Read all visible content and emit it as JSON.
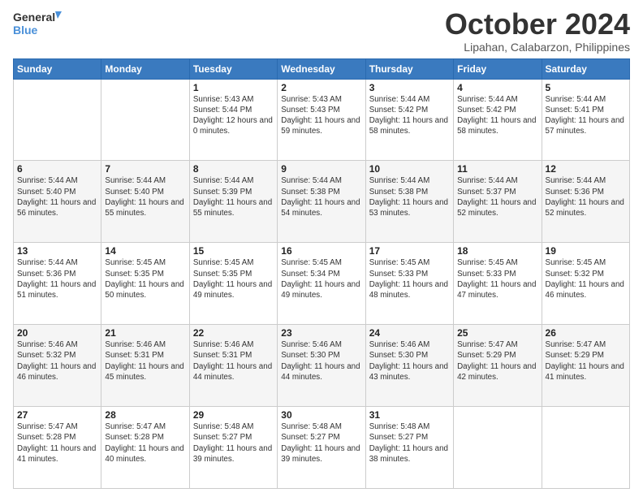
{
  "logo": {
    "line1": "General",
    "line2": "Blue"
  },
  "header": {
    "month": "October 2024",
    "location": "Lipahan, Calabarzon, Philippines"
  },
  "weekdays": [
    "Sunday",
    "Monday",
    "Tuesday",
    "Wednesday",
    "Thursday",
    "Friday",
    "Saturday"
  ],
  "weeks": [
    [
      {
        "day": "",
        "sunrise": "",
        "sunset": "",
        "daylight": ""
      },
      {
        "day": "",
        "sunrise": "",
        "sunset": "",
        "daylight": ""
      },
      {
        "day": "1",
        "sunrise": "Sunrise: 5:43 AM",
        "sunset": "Sunset: 5:44 PM",
        "daylight": "Daylight: 12 hours and 0 minutes."
      },
      {
        "day": "2",
        "sunrise": "Sunrise: 5:43 AM",
        "sunset": "Sunset: 5:43 PM",
        "daylight": "Daylight: 11 hours and 59 minutes."
      },
      {
        "day": "3",
        "sunrise": "Sunrise: 5:44 AM",
        "sunset": "Sunset: 5:42 PM",
        "daylight": "Daylight: 11 hours and 58 minutes."
      },
      {
        "day": "4",
        "sunrise": "Sunrise: 5:44 AM",
        "sunset": "Sunset: 5:42 PM",
        "daylight": "Daylight: 11 hours and 58 minutes."
      },
      {
        "day": "5",
        "sunrise": "Sunrise: 5:44 AM",
        "sunset": "Sunset: 5:41 PM",
        "daylight": "Daylight: 11 hours and 57 minutes."
      }
    ],
    [
      {
        "day": "6",
        "sunrise": "Sunrise: 5:44 AM",
        "sunset": "Sunset: 5:40 PM",
        "daylight": "Daylight: 11 hours and 56 minutes."
      },
      {
        "day": "7",
        "sunrise": "Sunrise: 5:44 AM",
        "sunset": "Sunset: 5:40 PM",
        "daylight": "Daylight: 11 hours and 55 minutes."
      },
      {
        "day": "8",
        "sunrise": "Sunrise: 5:44 AM",
        "sunset": "Sunset: 5:39 PM",
        "daylight": "Daylight: 11 hours and 55 minutes."
      },
      {
        "day": "9",
        "sunrise": "Sunrise: 5:44 AM",
        "sunset": "Sunset: 5:38 PM",
        "daylight": "Daylight: 11 hours and 54 minutes."
      },
      {
        "day": "10",
        "sunrise": "Sunrise: 5:44 AM",
        "sunset": "Sunset: 5:38 PM",
        "daylight": "Daylight: 11 hours and 53 minutes."
      },
      {
        "day": "11",
        "sunrise": "Sunrise: 5:44 AM",
        "sunset": "Sunset: 5:37 PM",
        "daylight": "Daylight: 11 hours and 52 minutes."
      },
      {
        "day": "12",
        "sunrise": "Sunrise: 5:44 AM",
        "sunset": "Sunset: 5:36 PM",
        "daylight": "Daylight: 11 hours and 52 minutes."
      }
    ],
    [
      {
        "day": "13",
        "sunrise": "Sunrise: 5:44 AM",
        "sunset": "Sunset: 5:36 PM",
        "daylight": "Daylight: 11 hours and 51 minutes."
      },
      {
        "day": "14",
        "sunrise": "Sunrise: 5:45 AM",
        "sunset": "Sunset: 5:35 PM",
        "daylight": "Daylight: 11 hours and 50 minutes."
      },
      {
        "day": "15",
        "sunrise": "Sunrise: 5:45 AM",
        "sunset": "Sunset: 5:35 PM",
        "daylight": "Daylight: 11 hours and 49 minutes."
      },
      {
        "day": "16",
        "sunrise": "Sunrise: 5:45 AM",
        "sunset": "Sunset: 5:34 PM",
        "daylight": "Daylight: 11 hours and 49 minutes."
      },
      {
        "day": "17",
        "sunrise": "Sunrise: 5:45 AM",
        "sunset": "Sunset: 5:33 PM",
        "daylight": "Daylight: 11 hours and 48 minutes."
      },
      {
        "day": "18",
        "sunrise": "Sunrise: 5:45 AM",
        "sunset": "Sunset: 5:33 PM",
        "daylight": "Daylight: 11 hours and 47 minutes."
      },
      {
        "day": "19",
        "sunrise": "Sunrise: 5:45 AM",
        "sunset": "Sunset: 5:32 PM",
        "daylight": "Daylight: 11 hours and 46 minutes."
      }
    ],
    [
      {
        "day": "20",
        "sunrise": "Sunrise: 5:46 AM",
        "sunset": "Sunset: 5:32 PM",
        "daylight": "Daylight: 11 hours and 46 minutes."
      },
      {
        "day": "21",
        "sunrise": "Sunrise: 5:46 AM",
        "sunset": "Sunset: 5:31 PM",
        "daylight": "Daylight: 11 hours and 45 minutes."
      },
      {
        "day": "22",
        "sunrise": "Sunrise: 5:46 AM",
        "sunset": "Sunset: 5:31 PM",
        "daylight": "Daylight: 11 hours and 44 minutes."
      },
      {
        "day": "23",
        "sunrise": "Sunrise: 5:46 AM",
        "sunset": "Sunset: 5:30 PM",
        "daylight": "Daylight: 11 hours and 44 minutes."
      },
      {
        "day": "24",
        "sunrise": "Sunrise: 5:46 AM",
        "sunset": "Sunset: 5:30 PM",
        "daylight": "Daylight: 11 hours and 43 minutes."
      },
      {
        "day": "25",
        "sunrise": "Sunrise: 5:47 AM",
        "sunset": "Sunset: 5:29 PM",
        "daylight": "Daylight: 11 hours and 42 minutes."
      },
      {
        "day": "26",
        "sunrise": "Sunrise: 5:47 AM",
        "sunset": "Sunset: 5:29 PM",
        "daylight": "Daylight: 11 hours and 41 minutes."
      }
    ],
    [
      {
        "day": "27",
        "sunrise": "Sunrise: 5:47 AM",
        "sunset": "Sunset: 5:28 PM",
        "daylight": "Daylight: 11 hours and 41 minutes."
      },
      {
        "day": "28",
        "sunrise": "Sunrise: 5:47 AM",
        "sunset": "Sunset: 5:28 PM",
        "daylight": "Daylight: 11 hours and 40 minutes."
      },
      {
        "day": "29",
        "sunrise": "Sunrise: 5:48 AM",
        "sunset": "Sunset: 5:27 PM",
        "daylight": "Daylight: 11 hours and 39 minutes."
      },
      {
        "day": "30",
        "sunrise": "Sunrise: 5:48 AM",
        "sunset": "Sunset: 5:27 PM",
        "daylight": "Daylight: 11 hours and 39 minutes."
      },
      {
        "day": "31",
        "sunrise": "Sunrise: 5:48 AM",
        "sunset": "Sunset: 5:27 PM",
        "daylight": "Daylight: 11 hours and 38 minutes."
      },
      {
        "day": "",
        "sunrise": "",
        "sunset": "",
        "daylight": ""
      },
      {
        "day": "",
        "sunrise": "",
        "sunset": "",
        "daylight": ""
      }
    ]
  ]
}
